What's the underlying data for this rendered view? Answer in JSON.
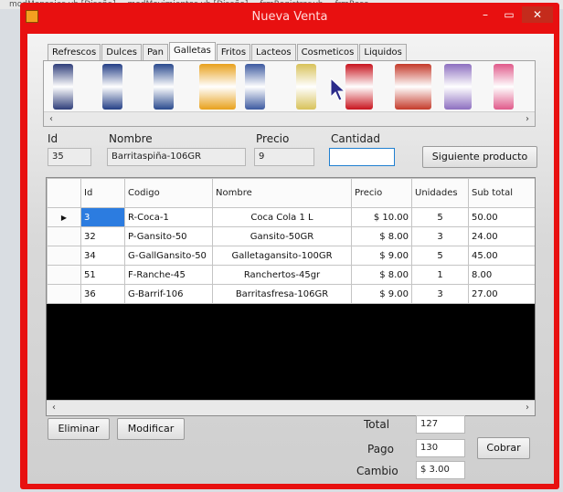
{
  "background_tabs": [
    "modMensajes.vb [Diseño]",
    "modMovimientos.vb [Diseño]",
    "frmRegistrar.vb",
    "frmRese"
  ],
  "window": {
    "title": "Nueva Venta",
    "accent_color": "#e81010",
    "controls": {
      "minimize": "–",
      "maximize": "▭",
      "close": "✕"
    }
  },
  "category_tabs": [
    "Refrescos",
    "Dulces",
    "Pan",
    "Galletas",
    "Fritos",
    "Lacteos",
    "Cosmeticos",
    "Liquidos"
  ],
  "selected_tab": "Galletas",
  "product_strip": {
    "scroll_left": "‹",
    "scroll_right": "›",
    "product_colors": [
      "#2f3e7a",
      "#243f86",
      "#2a4a8e",
      "#e8a11c",
      "#3d5aa0",
      "#d8c25a",
      "#c8141e",
      "#c43a2a",
      "#8d6fc0",
      "#e05a8a"
    ]
  },
  "fields": {
    "id_label": "Id",
    "id_value": "35",
    "nombre_label": "Nombre",
    "nombre_value": "Barritaspiña-106GR",
    "precio_label": "Precio",
    "precio_value": "9",
    "cantidad_label": "Cantidad",
    "cantidad_value": ""
  },
  "buttons": {
    "siguiente": "Siguiente producto",
    "eliminar": "Eliminar",
    "modificar": "Modificar",
    "cobrar": "Cobrar"
  },
  "grid": {
    "columns": [
      "Id",
      "Codigo",
      "Nombre",
      "Precio",
      "Unidades",
      "Sub total"
    ],
    "current_row_marker": "▶",
    "rows": [
      {
        "id": "3",
        "codigo": "R-Coca-1",
        "nombre": "Coca Cola 1 L",
        "precio": "$ 10.00",
        "unidades": "5",
        "subtotal": "50.00"
      },
      {
        "id": "32",
        "codigo": "P-Gansito-50",
        "nombre": "Gansito-50GR",
        "precio": "$ 8.00",
        "unidades": "3",
        "subtotal": "24.00"
      },
      {
        "id": "34",
        "codigo": "G-GallGansito-50",
        "nombre": "Galletagansito-100GR",
        "precio": "$ 9.00",
        "unidades": "5",
        "subtotal": "45.00"
      },
      {
        "id": "51",
        "codigo": "F-Ranche-45",
        "nombre": "Ranchertos-45gr",
        "precio": "$ 8.00",
        "unidades": "1",
        "subtotal": "8.00"
      },
      {
        "id": "36",
        "codigo": "G-Barrif-106",
        "nombre": "Barritasfresa-106GR",
        "precio": "$ 9.00",
        "unidades": "3",
        "subtotal": "27.00"
      }
    ]
  },
  "totals": {
    "total_label": "Total",
    "total_value": "127",
    "pago_label": "Pago",
    "pago_value": "130",
    "cambio_label": "Cambio",
    "cambio_value": "$ 3.00"
  }
}
